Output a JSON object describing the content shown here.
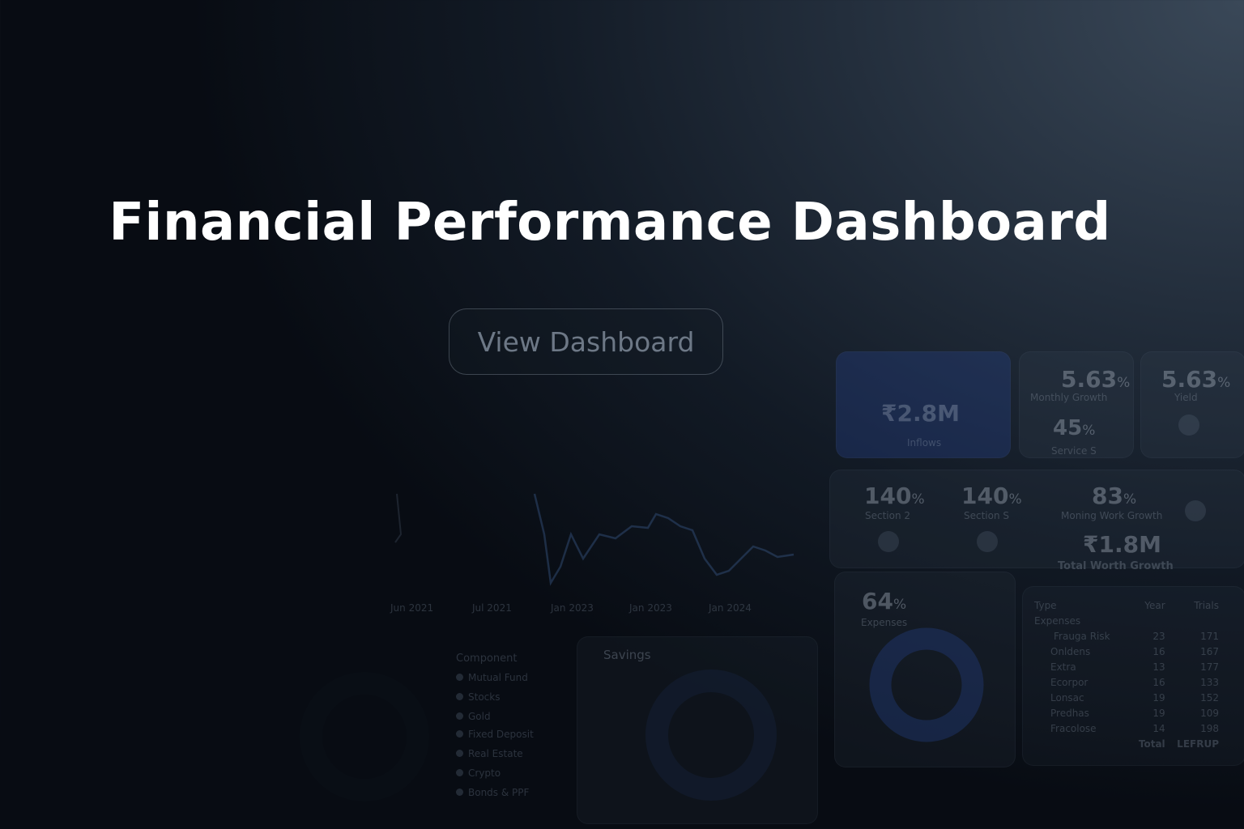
{
  "hero": {
    "title": "Financial Performance Dashboard",
    "button_label": "View Dashboard"
  },
  "background_dashboard": {
    "kpis": [
      {
        "value": "5.63",
        "unit": "%",
        "label": "Monthly Growth"
      },
      {
        "value": "5.63",
        "unit": "%",
        "label": "Yield"
      },
      {
        "value": "45",
        "unit": "%",
        "label": "Service S"
      },
      {
        "value": "₹2.8M",
        "unit": "",
        "label": "Inflows"
      },
      {
        "value": "140",
        "unit": "%",
        "label": "Section 2"
      },
      {
        "value": "140",
        "unit": "%",
        "label": "Section S"
      },
      {
        "value": "83",
        "unit": "%",
        "label": "Moning Work Growth"
      },
      {
        "value": "₹1.8M",
        "unit": "",
        "label": "Total Worth Growth"
      },
      {
        "value": "64",
        "unit": "%",
        "label": "Expenses"
      }
    ],
    "line_chart_x_labels": [
      "Jun 2021",
      "Jul 2021",
      "Jan 2023",
      "Jan 2023",
      "Jan 2024"
    ],
    "savings_label": "Savings",
    "component_label": "Component",
    "legend": [
      "Mutual Fund",
      "Stocks",
      "Gold",
      "Fixed Deposit",
      "Real Estate",
      "Crypto",
      "Bonds & PPF"
    ],
    "table": {
      "headers": [
        "Type",
        "Year",
        "Trials"
      ],
      "section": "Expenses",
      "rows": [
        [
          "Frauga Risk",
          "23",
          "171"
        ],
        [
          "Onldens",
          "16",
          "167"
        ],
        [
          "Extra",
          "13",
          "177"
        ],
        [
          "Ecorpor",
          "16",
          "133"
        ],
        [
          "Lonsac",
          "19",
          "152"
        ],
        [
          "Predhas",
          "19",
          "109"
        ],
        [
          "Fracolose",
          "14",
          "198"
        ]
      ],
      "total_label": "Total",
      "total_value": "LEFRUP"
    }
  },
  "colors": {
    "accent_blue": "#2f4f9a",
    "title_text": "#ffffff",
    "button_text": "#6d7886"
  }
}
